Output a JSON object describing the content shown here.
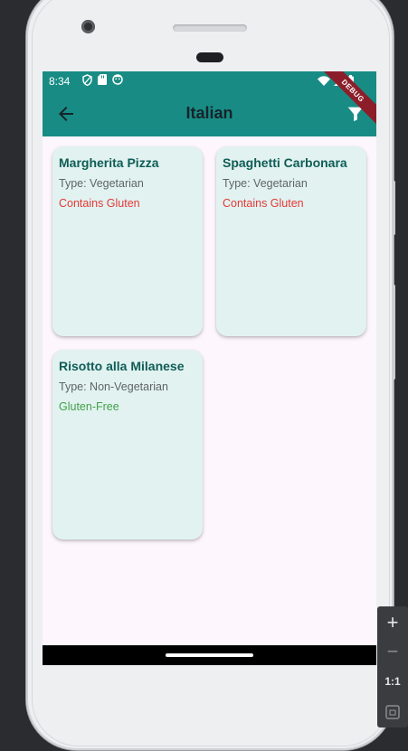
{
  "status_bar": {
    "time": "8:34",
    "left_icons": [
      "shield-icon",
      "sd-card-icon",
      "face-icon"
    ],
    "right_icons": [
      "wifi-icon",
      "signal-icon",
      "battery-icon"
    ]
  },
  "app_bar": {
    "title": "Italian",
    "back_icon": "arrow-left-icon",
    "filter_icon": "filter-icon",
    "debug_label": "DEBUG",
    "color": "#188c84"
  },
  "dishes": [
    {
      "name": "Margherita Pizza",
      "type": "Type: Vegetarian",
      "gluten": "Contains Gluten",
      "gluten_color": "#e53935"
    },
    {
      "name": "Spaghetti Carbonara",
      "type": "Type: Vegetarian",
      "gluten": "Contains Gluten",
      "gluten_color": "#e53935"
    },
    {
      "name": "Risotto alla Milanese",
      "type": "Type: Non-Vegetarian",
      "gluten": "Gluten-Free",
      "gluten_color": "#43a047"
    }
  ],
  "zoom_toolbar": {
    "zoom_in": "+",
    "zoom_out": "−",
    "actual_size": "1:1",
    "fit_icon": "fit-screen-icon"
  }
}
